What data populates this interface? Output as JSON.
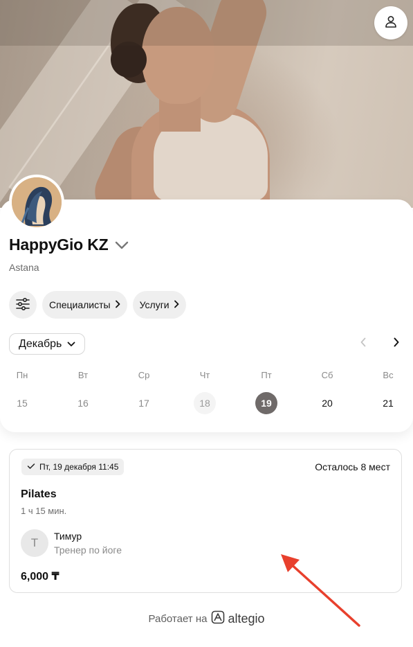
{
  "company": {
    "name": "HappyGio KZ",
    "city": "Astana"
  },
  "filters": {
    "specialists_label": "Специалисты",
    "services_label": "Услуги"
  },
  "calendar": {
    "month": "Декабрь",
    "weekdays": [
      "Пн",
      "Вт",
      "Ср",
      "Чт",
      "Пт",
      "Сб",
      "Вс"
    ],
    "dates": [
      "15",
      "16",
      "17",
      "18",
      "19",
      "20",
      "21"
    ],
    "selected": "19"
  },
  "event": {
    "datetime": "Пт, 19 декабря 11:45",
    "seats_left": "Осталось 8 мест",
    "title": "Pilates",
    "duration": "1 ч 15 мин.",
    "trainer": {
      "initial": "Т",
      "name": "Тимур",
      "role": "Тренер по йоге"
    },
    "price": "6,000 ₸"
  },
  "footer": {
    "powered_by": "Работает на",
    "brand": "altegio"
  },
  "colors": {
    "annotation_arrow": "#e8402d",
    "selected_day": "#6f6a69"
  }
}
